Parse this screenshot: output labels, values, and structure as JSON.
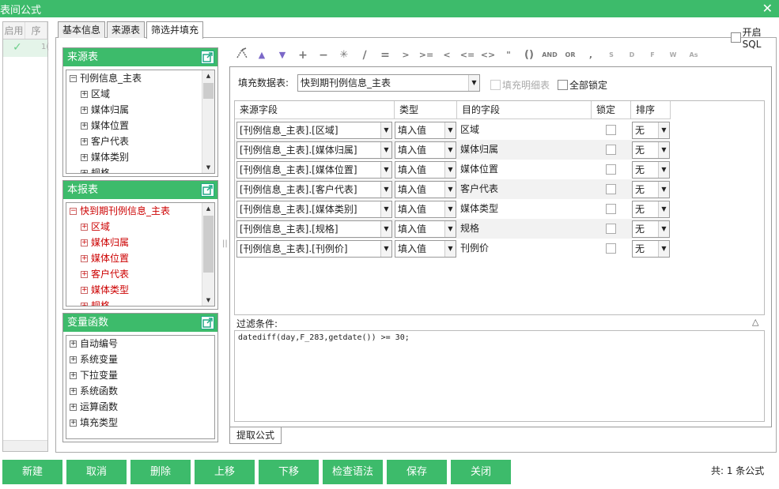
{
  "window": {
    "title": "表间公式",
    "close": "✕"
  },
  "left_list": {
    "headers": [
      "启用",
      "序"
    ],
    "row": {
      "check": "✓",
      "num": "1("
    }
  },
  "tabs": [
    "基本信息",
    "来源表",
    "筛选并填充"
  ],
  "open_sql": "开启SQL",
  "source_panel": {
    "title": "来源表",
    "items": [
      "刊例信息_主表",
      "区域",
      "媒体归属",
      "媒体位置",
      "客户代表",
      "媒体类别",
      "规格"
    ]
  },
  "report_panel": {
    "title": "本报表",
    "items": [
      "快到期刊例信息_主表",
      "区域",
      "媒体归属",
      "媒体位置",
      "客户代表",
      "媒体类型",
      "规格"
    ]
  },
  "var_panel": {
    "title": "变量函数",
    "items": [
      "自动编号",
      "系统变量",
      "下拉变量",
      "系统函数",
      "运算函数",
      "填充类型"
    ]
  },
  "toolbar": [
    "+",
    "−",
    "✳",
    "∕",
    "=",
    ">",
    ">=",
    "<",
    "<=",
    "<>",
    "\"",
    "()",
    "AND",
    "OR",
    ",",
    "S",
    "D",
    "F",
    "W",
    "As"
  ],
  "fill": {
    "label": "填充数据表:",
    "table": "快到期刊例信息_主表",
    "detail_label": "填充明细表",
    "lock_all_label": "全部锁定"
  },
  "grid": {
    "headers": [
      "来源字段",
      "类型",
      "目的字段",
      "锁定",
      "排序"
    ],
    "rows": [
      {
        "src": "[刊例信息_主表].[区域]",
        "type": "填入值",
        "dest": "区域",
        "sort": "无"
      },
      {
        "src": "[刊例信息_主表].[媒体归属]",
        "type": "填入值",
        "dest": "媒体归属",
        "sort": "无"
      },
      {
        "src": "[刊例信息_主表].[媒体位置]",
        "type": "填入值",
        "dest": "媒体位置",
        "sort": "无"
      },
      {
        "src": "[刊例信息_主表].[客户代表]",
        "type": "填入值",
        "dest": "客户代表",
        "sort": "无"
      },
      {
        "src": "[刊例信息_主表].[媒体类别]",
        "type": "填入值",
        "dest": "媒体类型",
        "sort": "无"
      },
      {
        "src": "[刊例信息_主表].[规格]",
        "type": "填入值",
        "dest": "规格",
        "sort": "无"
      },
      {
        "src": "[刊例信息_主表].[刊例价]",
        "type": "填入值",
        "dest": "刊例价",
        "sort": "无"
      }
    ]
  },
  "filter": {
    "label": "过滤条件:",
    "expr": "datediff(day,F_283,getdate())  >= 30;"
  },
  "bottom_tab": "提取公式",
  "buttons": [
    "新建",
    "取消",
    "删除",
    "上移",
    "下移",
    "检查语法",
    "保存",
    "关闭"
  ],
  "total": "共:  1 条公式"
}
